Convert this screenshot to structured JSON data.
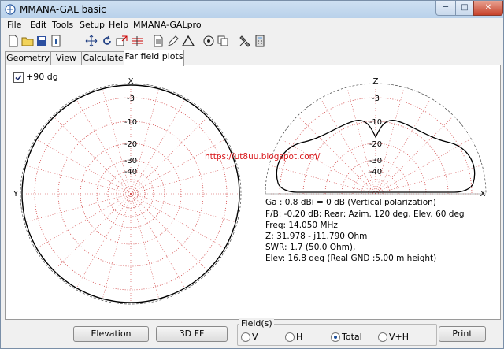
{
  "window": {
    "title": "MMANA-GAL basic",
    "min_glyph": "─",
    "max_glyph": "□",
    "close_glyph": "✕"
  },
  "menu": [
    "File",
    "Edit",
    "Tools",
    "Setup",
    "Help",
    "MMANA-GALpro"
  ],
  "toolbar_icons": [
    "new-file-icon",
    "open-folder-icon",
    "save-icon",
    "info-icon",
    "move-icon",
    "rotate-icon",
    "zoom-icon",
    "wires-icon",
    "document-icon",
    "edit-icon",
    "triangle-icon",
    "target-icon",
    "copy-icon",
    "tools-icon",
    "calculator-icon"
  ],
  "tabs": [
    "Geometry",
    "View",
    "Calculate",
    "Far field plots"
  ],
  "active_tab": "Far field plots",
  "checkbox": {
    "label": "+90 dg",
    "checked": true
  },
  "left_plot": {
    "top_label": "X",
    "side_label": "Y",
    "rings": [
      "-3",
      "-10",
      "-20",
      "-30",
      "-40"
    ]
  },
  "right_plot": {
    "top_label": "Z",
    "side_label": "X",
    "rings": [
      "-3",
      "-10",
      "-20",
      "-30",
      "-40"
    ]
  },
  "url": "https://ut8uu.blogspot.com/",
  "info": {
    "ga": "Ga : 0.8 dBi = 0 dB  (Vertical polarization)",
    "fb": "F/B: -0.20 dB; Rear: Azim. 120 deg,  Elev. 60 deg",
    "freq": "Freq: 14.050 MHz",
    "z": "Z: 31.978 - j11.790 Ohm",
    "swr": "SWR: 1.7 (50.0 Ohm),",
    "elev": "Elev: 16.8 deg (Real GND  :5.00 m height)"
  },
  "buttons": {
    "elevation": "Elevation",
    "ff3d": "3D FF",
    "print": "Print"
  },
  "fields": {
    "legend": "Field(s)",
    "options": [
      "V",
      "H",
      "Total",
      "V+H"
    ],
    "selected": "Total"
  },
  "colors": {
    "grid_dotted": "#d04040",
    "pattern": "#000000",
    "url": "#d8161a",
    "titlebar": "#b9d1ea"
  }
}
